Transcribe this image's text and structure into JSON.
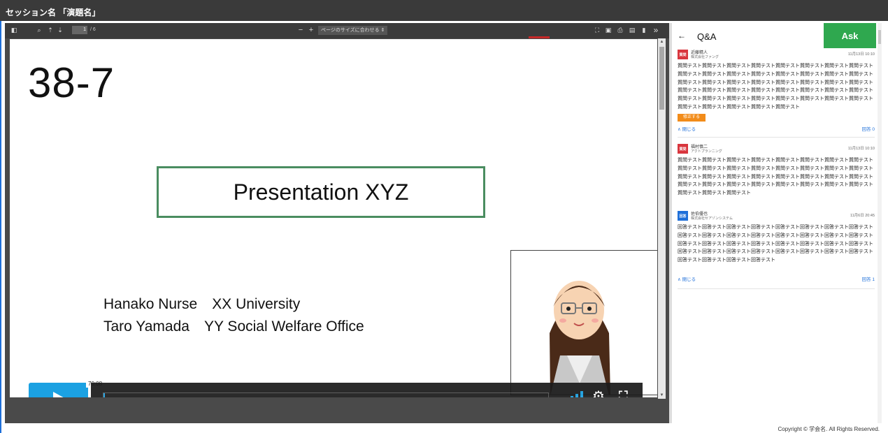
{
  "session_title": "セッション名 「演題名」",
  "pdf_toolbar": {
    "page_current": "1",
    "page_total": "/ 6",
    "zoom_minus": "−",
    "zoom_plus": "+",
    "zoom_select": "ページのサイズに合わせる",
    "more": "»"
  },
  "slide": {
    "number": "38-7",
    "title": "Presentation XYZ",
    "author_lines": [
      "Hanako Nurse　XX University",
      "Taro Yamada　YY Social Welfare Office"
    ]
  },
  "player": {
    "time_tooltip": "70:08",
    "progress": 0.003,
    "volume_level": 5
  },
  "qa": {
    "back_icon": "back-arrow-icon",
    "title": "Q&A",
    "ask_label": "Ask",
    "posts": [
      {
        "type": "question",
        "badge": "質問",
        "badge_color": "#d9363e",
        "author": "近藤精人",
        "org": "株式会社ファング",
        "date": "11月13日 10:10",
        "body": "質問テスト質問テスト質問テスト質問テスト質問テスト質問テスト質問テスト質問テスト質問テスト質問テスト質問テスト質問テスト質問テスト質問テスト質問テスト質問テスト質問テスト質問テスト質問テスト質問テスト質問テスト質問テスト質問テスト質問テスト質問テスト質問テスト質問テスト質問テスト質問テスト質問テスト質問テスト質問テスト質問テスト質問テスト質問テスト質問テスト質問テスト質問テスト質問テスト質問テスト質問テスト質問テスト質問テスト質問テスト質問テスト",
        "edit_label": "修正する",
        "toggle_label": "閉じる",
        "count_label": "回答 0"
      },
      {
        "type": "question",
        "badge": "質問",
        "badge_color": "#d9363e",
        "author": "福村慎二",
        "org": "アクトプランニング",
        "date": "11月13日 10:10",
        "body": "質問テスト質問テスト質問テスト質問テスト質問テスト質問テスト質問テスト質問テスト質問テスト質問テスト質問テスト質問テスト質問テスト質問テスト質問テスト質問テスト質問テスト質問テスト質問テスト質問テスト質問テスト質問テスト質問テスト質問テスト質問テスト質問テスト質問テスト質問テスト質問テスト質問テスト質問テスト質問テスト質問テスト質問テスト質問テスト"
      },
      {
        "type": "answer",
        "badge": "回答",
        "badge_color": "#1e6fd9",
        "author": "佐伯優也",
        "org": "株式会社セアゾンシステム",
        "date": "11月6日 20:45",
        "body": "回答テスト回答テスト回答テスト回答テスト回答テスト回答テスト回答テスト回答テスト回答テスト回答テスト回答テスト回答テスト回答テスト回答テスト回答テスト回答テスト回答テスト回答テスト回答テスト回答テスト回答テスト回答テスト回答テスト回答テスト回答テスト回答テスト回答テスト回答テスト回答テスト回答テスト回答テスト回答テスト回答テスト回答テスト回答テスト回答テスト",
        "toggle_label": "閉じる",
        "count_label": "回答 1"
      }
    ]
  },
  "footer": "Copyright © 学会名. All Rights Reserved."
}
